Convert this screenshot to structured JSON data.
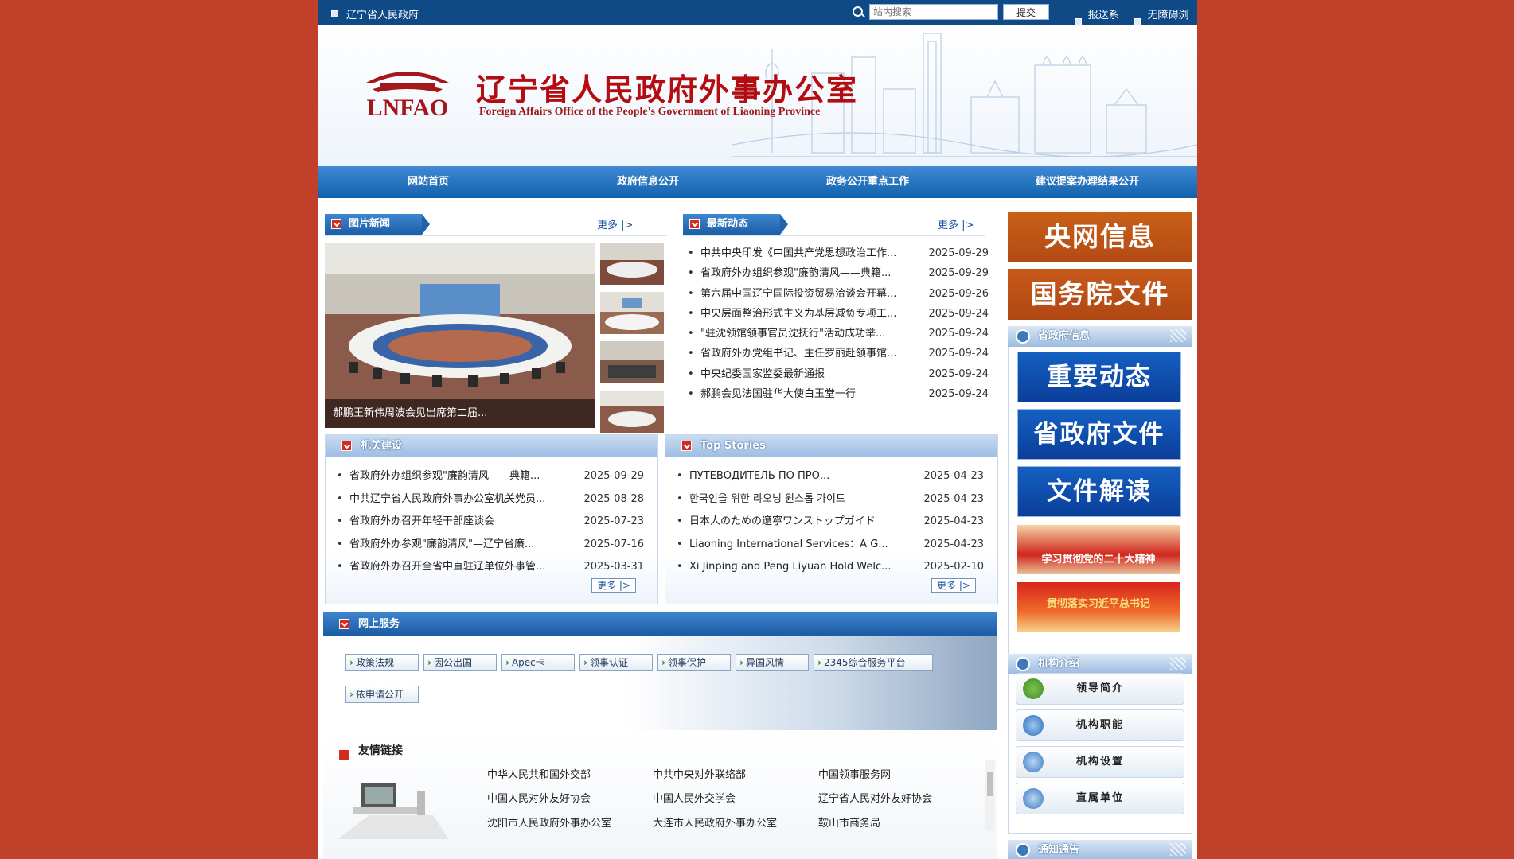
{
  "topbar": {
    "site_name": "辽宁省人民政府",
    "search_placeholder": "站内搜索",
    "search_button": "提交",
    "links": [
      "报送系统",
      "无障碍浏览"
    ]
  },
  "banner": {
    "emblem_text": "LNFAO",
    "title": "辽宁省人民政府外事办公室",
    "subtitle": "Foreign Affairs Office of the People's Government of Liaoning Province"
  },
  "nav": [
    "网站首页",
    "政府信息公开",
    "政务公开重点工作",
    "建议提案办理结果公开"
  ],
  "photo_news": {
    "title": "图片新闻",
    "more": "更多 |>",
    "caption": "郝鹏王新伟周波会见出席第二届..."
  },
  "latest": {
    "title": "最新动态",
    "more": "更多 |>",
    "items": [
      {
        "title": "中共中央印发《中国共产党思想政治工作...",
        "date": "2025-09-29"
      },
      {
        "title": "省政府外办组织参观\"廉韵清风——典籍...",
        "date": "2025-09-29"
      },
      {
        "title": "第六届中国辽宁国际投资贸易洽谈会开幕...",
        "date": "2025-09-26"
      },
      {
        "title": "中央层面整治形式主义为基层减负专项工...",
        "date": "2025-09-24"
      },
      {
        "title": "\"驻沈领馆领事官员沈抚行\"活动成功举...",
        "date": "2025-09-24"
      },
      {
        "title": "省政府外办党组书记、主任罗丽赴领事馆...",
        "date": "2025-09-24"
      },
      {
        "title": "中央纪委国家监委最新通报",
        "date": "2025-09-24"
      },
      {
        "title": "郝鹏会见法国驻华大使白玉堂一行",
        "date": "2025-09-24"
      }
    ]
  },
  "org_building": {
    "title": "机关建设",
    "more": "更多 |>",
    "items": [
      {
        "title": "省政府外办组织参观\"廉韵清风——典籍...",
        "date": "2025-09-29"
      },
      {
        "title": "中共辽宁省人民政府外事办公室机关党员...",
        "date": "2025-08-28"
      },
      {
        "title": "省政府外办召开年轻干部座谈会",
        "date": "2025-07-23"
      },
      {
        "title": "省政府外办参观\"廉韵清风\"—辽宁省廉...",
        "date": "2025-07-16"
      },
      {
        "title": "省政府外办召开全省中直驻辽单位外事管...",
        "date": "2025-03-31"
      }
    ]
  },
  "top_stories": {
    "title": "Top Stories",
    "more": "更多 |>",
    "items": [
      {
        "title": "ПУТЕВОДИТЕЛЬ ПО ПРО...",
        "date": "2025-04-23"
      },
      {
        "title": "한국인을 위한 랴오닝 원스톱 가이드",
        "date": "2025-04-23"
      },
      {
        "title": "日本人のための遼寧ワンストップガイド",
        "date": "2025-04-23"
      },
      {
        "title": "Liaoning International Services：A G...",
        "date": "2025-04-23"
      },
      {
        "title": "Xi Jinping and Peng Liyuan Hold Welc...",
        "date": "2025-02-10"
      }
    ]
  },
  "online_service": {
    "title": "网上服务",
    "buttons": [
      "政策法规",
      "因公出国",
      "Apec卡",
      "领事认证",
      "领事保护",
      "异国风情",
      "2345综合服务平台",
      "依申请公开"
    ]
  },
  "friend_links": {
    "title": "友情链接",
    "links": [
      "中华人民共和国外交部",
      "中共中央对外联络部",
      "中国领事服务网",
      "中国人民对外友好协会",
      "中国人民外交学会",
      "辽宁省人民对外友好协会",
      "沈阳市人民政府外事办公室",
      "大连市人民政府外事办公室",
      "鞍山市商务局"
    ]
  },
  "right": {
    "cctv": "央网信息",
    "state_council": "国务院文件",
    "prov_info_title": "省政府信息",
    "prov_buttons": [
      "重要动态",
      "省政府文件",
      "文件解读"
    ],
    "promo1": "学习贯彻党的二十大精神",
    "promo2": "贯彻落实习近平总书记",
    "org_intro_title": "机构介绍",
    "org_buttons": [
      "领导简介",
      "机构职能",
      "机构设置",
      "直属单位"
    ],
    "notice_title": "通知通告"
  }
}
